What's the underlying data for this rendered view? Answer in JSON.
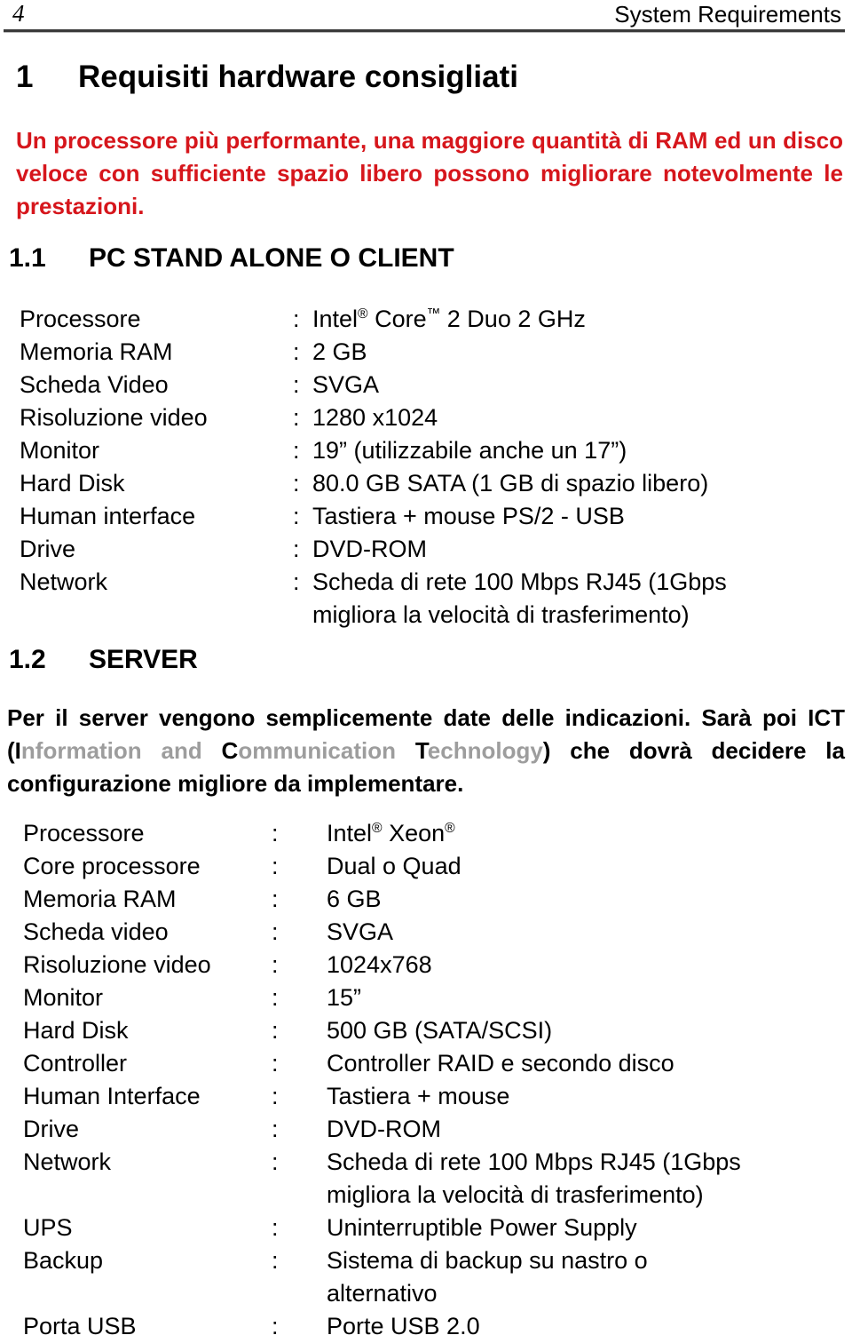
{
  "header": {
    "page_number": "4",
    "title": "System Requirements"
  },
  "chapter": {
    "number": "1",
    "title": "Requisiti hardware consigliati"
  },
  "intro_paragraph": "Un processore più performante, una maggiore quantità di RAM ed un disco veloce con sufficiente spazio libero possono migliorare notevolmente le prestazioni.",
  "section_pc": {
    "number": "1.1",
    "title": "PC STAND ALONE O CLIENT",
    "rows": [
      {
        "label": "Processore",
        "colon": ":",
        "value_pre": "Intel",
        "sup1": "®",
        "value_mid": " Core",
        "sup2": "™",
        "value_post": " 2 Duo 2 GHz"
      },
      {
        "label": "Memoria RAM",
        "colon": ":",
        "value": "2 GB"
      },
      {
        "label": "Scheda Video",
        "colon": ":",
        "value": "SVGA"
      },
      {
        "label": "Risoluzione video",
        "colon": ":",
        "value": "1280 x1024"
      },
      {
        "label": "Monitor",
        "colon": ":",
        "value": "19” (utilizzabile anche un 17”)"
      },
      {
        "label": "Hard Disk",
        "colon": ":",
        "value": "80.0 GB SATA (1 GB di spazio libero)"
      },
      {
        "label": "Human interface",
        "colon": ":",
        "value": "Tastiera + mouse PS/2 - USB"
      },
      {
        "label": "Drive",
        "colon": ":",
        "value": "DVD-ROM"
      },
      {
        "label": "Network",
        "colon": ":",
        "value": "Scheda di rete 100 Mbps RJ45 (1Gbps",
        "value_line2": "migliora la velocità di trasferimento)"
      }
    ]
  },
  "section_server": {
    "number": "1.2",
    "title": "SERVER",
    "paragraph": {
      "part1": "Per il server vengono semplicemente date delle indicazioni. Sarà poi ICT (",
      "i_cap": "I",
      "i_rest": "nformation and ",
      "c_cap": "C",
      "c_rest": "ommunication ",
      "t_cap": "T",
      "t_rest": "echnology",
      "part2": ") che dovrà decidere la configurazione migliore da implementare."
    },
    "rows": [
      {
        "label": "Processore",
        "colon": ":",
        "value_pre": "Intel",
        "sup1": "®",
        "value_mid": " Xeon",
        "sup2": "®",
        "value_post": ""
      },
      {
        "label": "Core processore",
        "colon": ":",
        "value": "Dual o Quad"
      },
      {
        "label": "Memoria RAM",
        "colon": ":",
        "value": "6 GB"
      },
      {
        "label": "Scheda video",
        "colon": ":",
        "value": "SVGA"
      },
      {
        "label": "Risoluzione video",
        "colon": ":",
        "value": "1024x768"
      },
      {
        "label": "Monitor",
        "colon": ":",
        "value": "15”"
      },
      {
        "label": "Hard Disk",
        "colon": ":",
        "value": "500 GB (SATA/SCSI)"
      },
      {
        "label": "Controller",
        "colon": ":",
        "value": "Controller RAID e secondo disco"
      },
      {
        "label": "Human Interface",
        "colon": ":",
        "value": "Tastiera + mouse"
      },
      {
        "label": "Drive",
        "colon": ":",
        "value": "DVD-ROM"
      },
      {
        "label": "Network",
        "colon": ":",
        "value": "Scheda di rete 100 Mbps RJ45 (1Gbps",
        "value_line2": "migliora la velocità di trasferimento)"
      },
      {
        "label": "UPS",
        "colon": ":",
        "value": "Uninterruptible Power Supply"
      },
      {
        "label": "Backup",
        "colon": ":",
        "value": "Sistema di backup su nastro o",
        "value_line2": "alternativo"
      },
      {
        "label": "Porta USB",
        "colon": ":",
        "value": "Porte USB 2.0"
      }
    ]
  },
  "colors": {
    "intro_red": "#d6161c",
    "grey_text": "#9d9d9d",
    "rule": "#3a3a3a"
  }
}
